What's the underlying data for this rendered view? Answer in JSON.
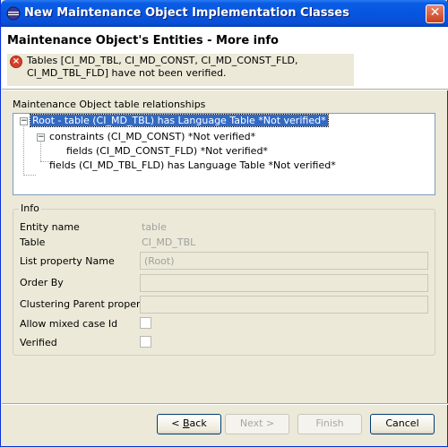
{
  "window": {
    "title": "New Maintenance Object Implementation Classes",
    "close_glyph": "✕"
  },
  "header": {
    "page_title": "Maintenance Object's Entities - More info",
    "error_icon": "error-icon",
    "error_message": "Tables [CI_MD_TBL, CI_MD_CONST, CI_MD_CONST_FLD, CI_MD_TBL_FLD] have not been verified."
  },
  "relationships": {
    "label": "Maintenance Object table relationships",
    "tree": [
      {
        "text": "Root - table   (CI_MD_TBL) has Language Table  *Not verified*",
        "selected": true
      },
      {
        "text": "constraints   (CI_MD_CONST) *Not verified*"
      },
      {
        "text": "fields   (CI_MD_CONST_FLD) *Not verified*"
      },
      {
        "text": "fields   (CI_MD_TBL_FLD) has Language Table  *Not verified*"
      }
    ]
  },
  "info": {
    "legend": "Info",
    "entity_name_label": "Entity name",
    "entity_name_value": "table",
    "table_label": "Table",
    "table_value": "CI_MD_TBL",
    "list_property_label": "List property Name",
    "list_property_value": "(Root)",
    "order_by_label": "Order By",
    "order_by_value": "",
    "clustering_label": "Clustering Parent property",
    "clustering_value": "",
    "mixed_case_label": "Allow mixed case Id",
    "verified_label": "Verified"
  },
  "buttons": {
    "back_prefix": "< ",
    "back_mnemonic": "B",
    "back_rest": "ack",
    "next_label": "Next >",
    "finish_label": "Finish",
    "cancel_label": "Cancel"
  }
}
